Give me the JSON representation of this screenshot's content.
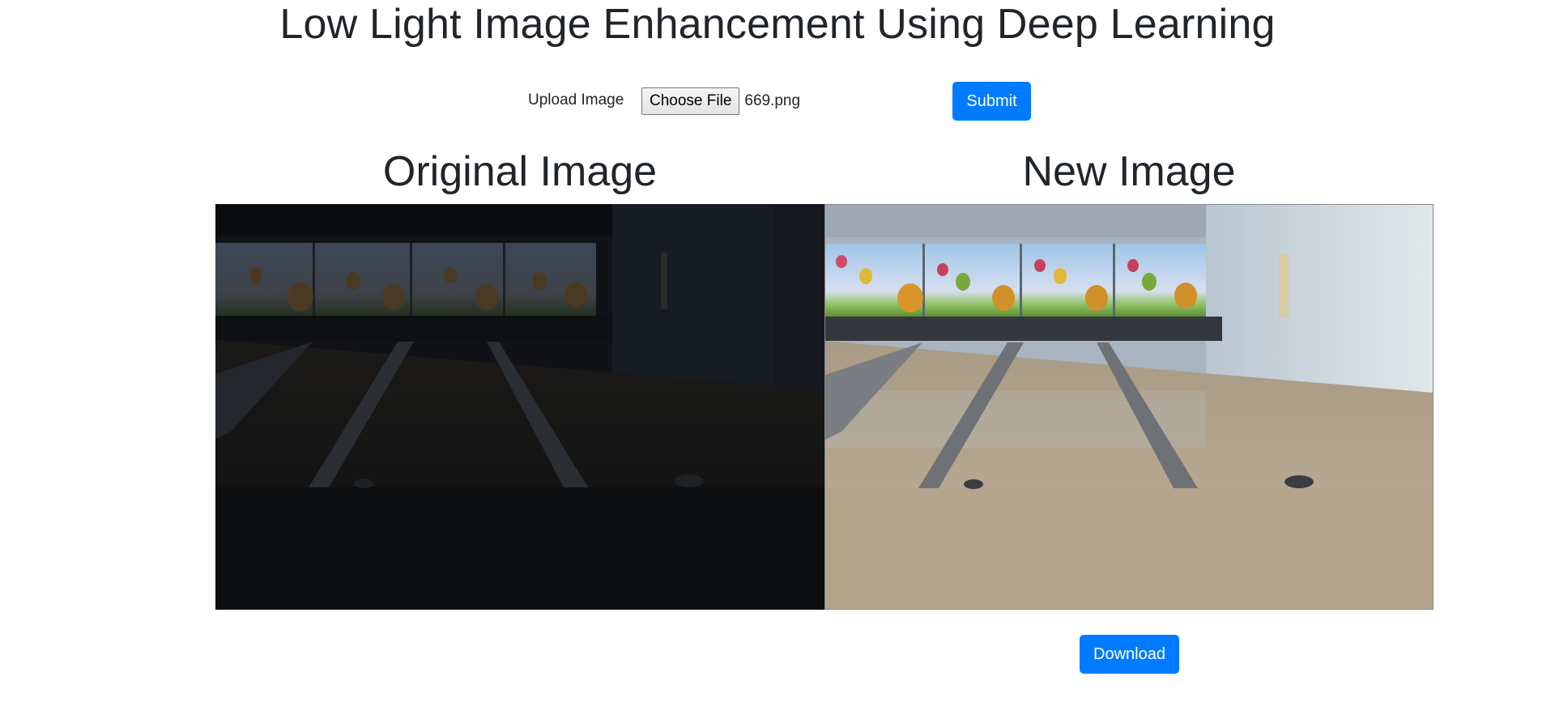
{
  "header": {
    "title": "Low Light Image Enhancement Using Deep Learning"
  },
  "upload": {
    "label": "Upload Image",
    "choose_file_label": "Choose File",
    "file_name": "669.png",
    "submit_label": "Submit"
  },
  "original": {
    "title": "Original Image"
  },
  "enhanced": {
    "title": "New Image"
  },
  "actions": {
    "download_label": "Download"
  },
  "colors": {
    "primary": "#007bff",
    "text": "#212529"
  }
}
